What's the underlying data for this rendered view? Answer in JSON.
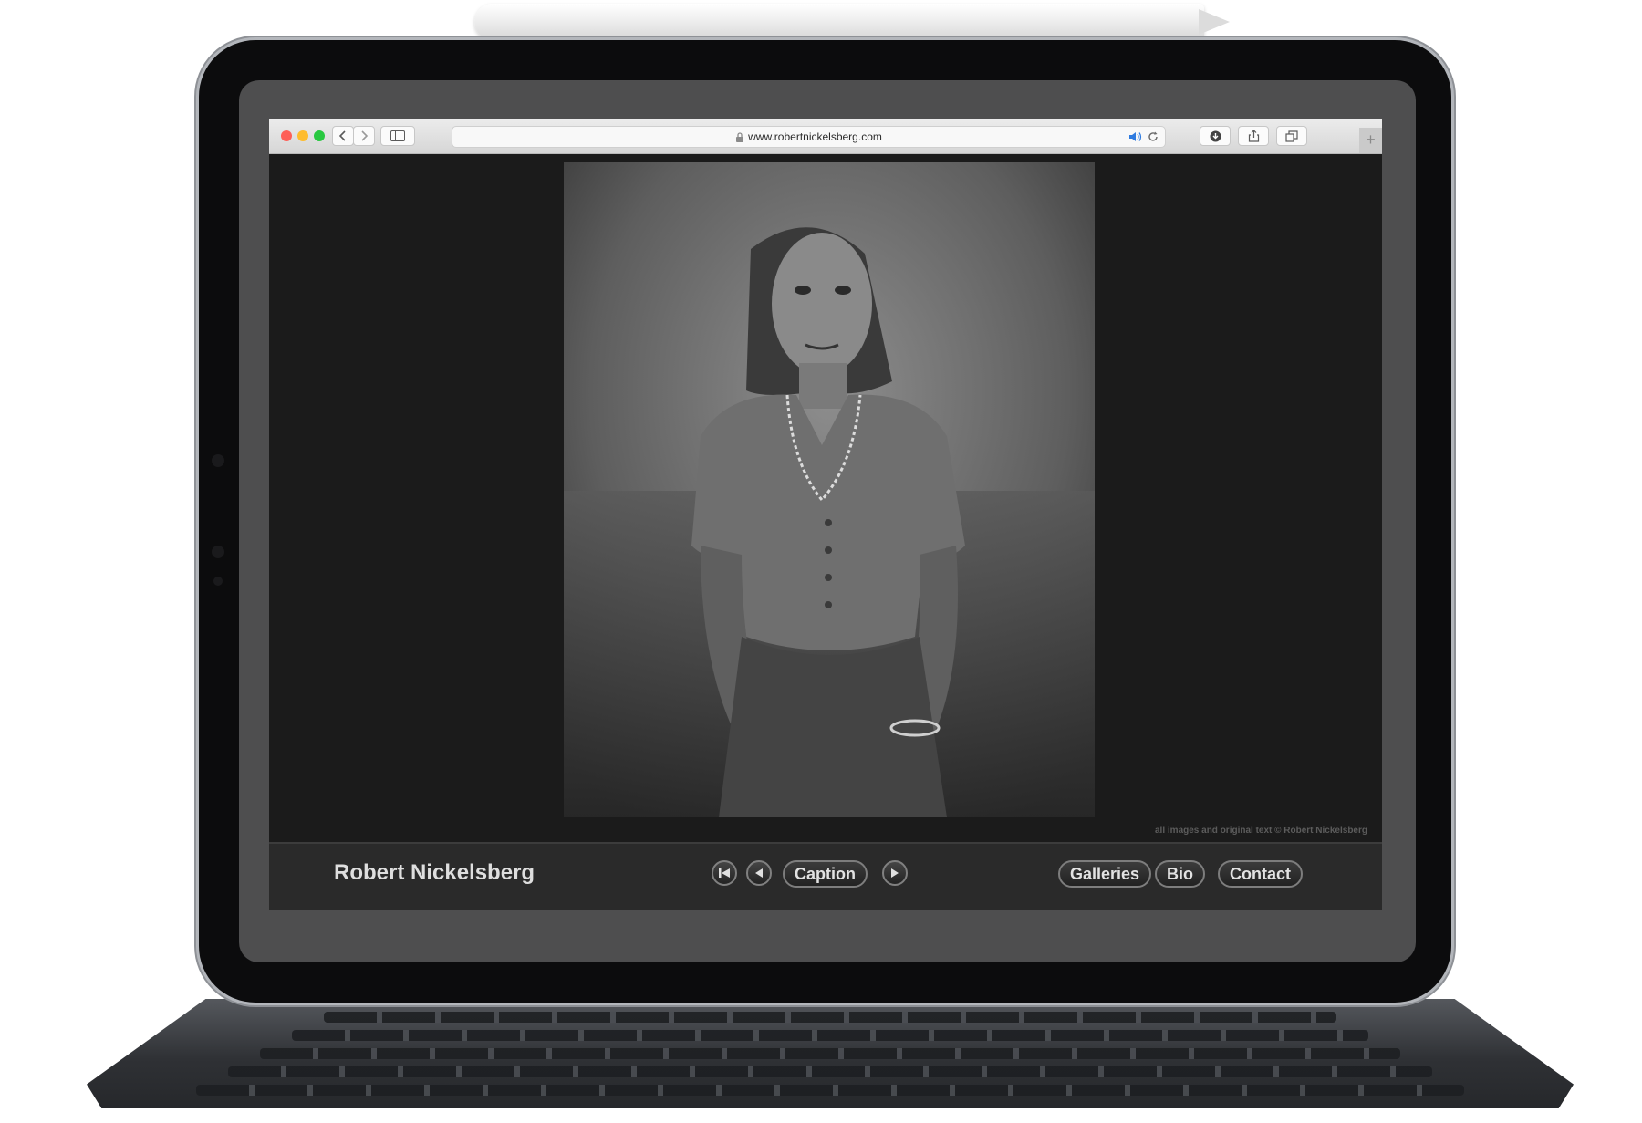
{
  "browser": {
    "url": "www.robertnickelsberg.com",
    "tab_plus": "+"
  },
  "page": {
    "photo_alt": "Black and white portrait of a woman",
    "copyright": "all images and original text © Robert Nickelsberg"
  },
  "footer": {
    "site_name": "Robert Nickelsberg",
    "caption_label": "Caption",
    "nav": {
      "galleries": "Galleries",
      "bio": "Bio",
      "contact": "Contact"
    }
  },
  "colors": {
    "page_background": "#1b1b1b",
    "footer_background": "#2a2a2a",
    "pill_border": "#7d7d7d",
    "traffic_red": "#fe5f57",
    "traffic_yellow": "#febc2e",
    "traffic_green": "#28c840"
  },
  "icons": {
    "first": "skip-to-first-icon",
    "prev": "previous-arrow-icon",
    "next": "next-arrow-icon",
    "lock": "lock-icon",
    "speaker": "speaker-icon",
    "reload": "reload-icon",
    "download": "download-icon",
    "share": "share-icon",
    "tabs": "tabs-overview-icon",
    "sidebar": "sidebar-icon"
  }
}
